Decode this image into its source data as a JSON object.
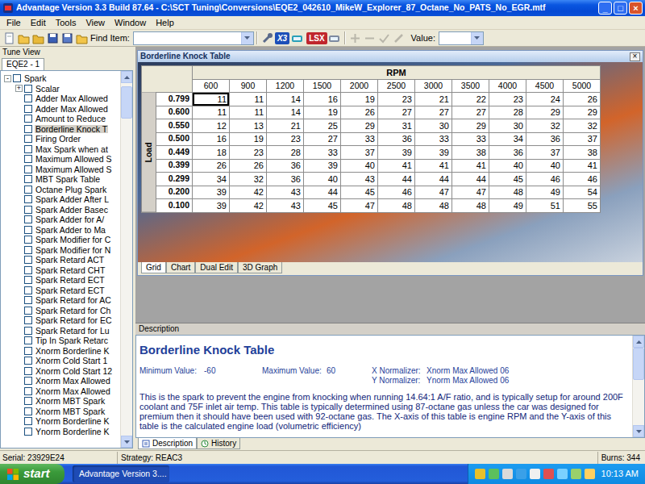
{
  "window": {
    "title": "Advantage Version 3.3 Build 87.64 - C:\\SCT Tuning\\Conversions\\EQE2_042610_MikeW_Explorer_87_Octane_No_PATS_No_EGR.mtf",
    "controls": [
      "_",
      "□",
      "×"
    ]
  },
  "menu": [
    "File",
    "Edit",
    "Tools",
    "View",
    "Window",
    "Help"
  ],
  "toolbar": {
    "find_label": "Find Item:",
    "value_label": "Value:",
    "badges": [
      {
        "label": "X3",
        "color": "#1d4fb8"
      },
      {
        "label": "LSX",
        "color": "#c0262d"
      }
    ]
  },
  "tune_view": {
    "title": "Tune View",
    "tab": {
      "label": "EQE2 - 1",
      "selected": true
    },
    "tree": [
      {
        "label": "Spark",
        "depth": 0,
        "toggle": "-",
        "checked": false,
        "selected": false
      },
      {
        "label": "Scalar",
        "depth": 1,
        "toggle": "+",
        "checked": false,
        "selected": false
      },
      {
        "label": "Adder Max Allowed",
        "depth": 1,
        "toggle": "",
        "checked": false,
        "selected": false
      },
      {
        "label": "Adder Max Allowed",
        "depth": 1,
        "toggle": "",
        "checked": false,
        "selected": false
      },
      {
        "label": "Amount to Reduce",
        "depth": 1,
        "toggle": "",
        "checked": false,
        "selected": false
      },
      {
        "label": "Borderline Knock T",
        "depth": 1,
        "toggle": "",
        "checked": false,
        "selected": true
      },
      {
        "label": "Firing Order",
        "depth": 1,
        "toggle": "",
        "checked": false,
        "selected": false
      },
      {
        "label": "Max Spark when at",
        "depth": 1,
        "toggle": "",
        "checked": false,
        "selected": false
      },
      {
        "label": "Maximum Allowed S",
        "depth": 1,
        "toggle": "",
        "checked": false,
        "selected": false
      },
      {
        "label": "Maximum Allowed S",
        "depth": 1,
        "toggle": "",
        "checked": false,
        "selected": false
      },
      {
        "label": "MBT Spark Table",
        "depth": 1,
        "toggle": "",
        "checked": false,
        "selected": false
      },
      {
        "label": "Octane Plug Spark",
        "depth": 1,
        "toggle": "",
        "checked": false,
        "selected": false
      },
      {
        "label": "Spark Adder After L",
        "depth": 1,
        "toggle": "",
        "checked": false,
        "selected": false
      },
      {
        "label": "Spark Adder Basec",
        "depth": 1,
        "toggle": "",
        "checked": false,
        "selected": false
      },
      {
        "label": "Spark Adder for A/",
        "depth": 1,
        "toggle": "",
        "checked": false,
        "selected": false
      },
      {
        "label": "Spark Adder to Ma",
        "depth": 1,
        "toggle": "",
        "checked": false,
        "selected": false
      },
      {
        "label": "Spark Modifier for C",
        "depth": 1,
        "toggle": "",
        "checked": false,
        "selected": false
      },
      {
        "label": "Spark Modifier for N",
        "depth": 1,
        "toggle": "",
        "checked": false,
        "selected": false
      },
      {
        "label": "Spark Retard ACT",
        "depth": 1,
        "toggle": "",
        "checked": false,
        "selected": false
      },
      {
        "label": "Spark Retard CHT",
        "depth": 1,
        "toggle": "",
        "checked": false,
        "selected": false
      },
      {
        "label": "Spark Retard ECT",
        "depth": 1,
        "toggle": "",
        "checked": false,
        "selected": false
      },
      {
        "label": "Spark Retard ECT",
        "depth": 1,
        "toggle": "",
        "checked": false,
        "selected": false
      },
      {
        "label": "Spark Retard for AC",
        "depth": 1,
        "toggle": "",
        "checked": false,
        "selected": false
      },
      {
        "label": "Spark Retard for Ch",
        "depth": 1,
        "toggle": "",
        "checked": false,
        "selected": false
      },
      {
        "label": "Spark Retard for EC",
        "depth": 1,
        "toggle": "",
        "checked": false,
        "selected": false
      },
      {
        "label": "Spark Retard for Lu",
        "depth": 1,
        "toggle": "",
        "checked": false,
        "selected": false
      },
      {
        "label": "Tip In Spark Retarc",
        "depth": 1,
        "toggle": "",
        "checked": false,
        "selected": false
      },
      {
        "label": "Xnorm Borderline K",
        "depth": 1,
        "toggle": "",
        "checked": false,
        "selected": false
      },
      {
        "label": "Xnorm Cold Start 1",
        "depth": 1,
        "toggle": "",
        "checked": false,
        "selected": false
      },
      {
        "label": "Xnorm Cold Start 12",
        "depth": 1,
        "toggle": "",
        "checked": false,
        "selected": false
      },
      {
        "label": "Xnorm Max Allowed",
        "depth": 1,
        "toggle": "",
        "checked": false,
        "selected": false
      },
      {
        "label": "Xnorm Max Allowed",
        "depth": 1,
        "toggle": "",
        "checked": false,
        "selected": false
      },
      {
        "label": "Xnorm MBT Spark",
        "depth": 1,
        "toggle": "",
        "checked": false,
        "selected": false
      },
      {
        "label": "Xnorm MBT Spark",
        "depth": 1,
        "toggle": "",
        "checked": false,
        "selected": false
      },
      {
        "label": "Ynorm Borderline K",
        "depth": 1,
        "toggle": "",
        "checked": false,
        "selected": false
      },
      {
        "label": "Ynorm Borderline K",
        "depth": 1,
        "toggle": "",
        "checked": false,
        "selected": false
      }
    ]
  },
  "table_window": {
    "title": "Borderline Knock Table",
    "close": "×",
    "x_axis": "RPM",
    "y_axis": "Load",
    "columns": [
      "600",
      "900",
      "1200",
      "1500",
      "2000",
      "2500",
      "3000",
      "3500",
      "4000",
      "4500",
      "5000"
    ],
    "selected_cell": [
      0,
      0
    ],
    "rows": [
      {
        "load": "0.799",
        "cells": [
          "11",
          "11",
          "14",
          "16",
          "19",
          "23",
          "21",
          "22",
          "23",
          "24",
          "26"
        ]
      },
      {
        "load": "0.600",
        "cells": [
          "11",
          "11",
          "14",
          "19",
          "26",
          "27",
          "27",
          "27",
          "28",
          "29",
          "29"
        ]
      },
      {
        "load": "0.550",
        "cells": [
          "12",
          "13",
          "21",
          "25",
          "29",
          "31",
          "30",
          "29",
          "30",
          "32",
          "32"
        ]
      },
      {
        "load": "0.500",
        "cells": [
          "16",
          "19",
          "23",
          "27",
          "33",
          "36",
          "33",
          "33",
          "34",
          "36",
          "37"
        ]
      },
      {
        "load": "0.449",
        "cells": [
          "18",
          "23",
          "28",
          "33",
          "37",
          "39",
          "39",
          "38",
          "36",
          "37",
          "38"
        ]
      },
      {
        "load": "0.399",
        "cells": [
          "26",
          "26",
          "36",
          "39",
          "40",
          "41",
          "41",
          "41",
          "40",
          "40",
          "41"
        ]
      },
      {
        "load": "0.299",
        "cells": [
          "34",
          "32",
          "36",
          "40",
          "43",
          "44",
          "44",
          "44",
          "45",
          "46",
          "46"
        ]
      },
      {
        "load": "0.200",
        "cells": [
          "39",
          "42",
          "43",
          "44",
          "45",
          "46",
          "47",
          "47",
          "48",
          "49",
          "54"
        ]
      },
      {
        "load": "0.100",
        "cells": [
          "39",
          "42",
          "43",
          "45",
          "47",
          "48",
          "48",
          "48",
          "49",
          "51",
          "55"
        ]
      }
    ],
    "tabs": [
      {
        "label": "Grid",
        "selected": true
      },
      {
        "label": "Chart",
        "selected": false
      },
      {
        "label": "Dual Edit",
        "selected": false
      },
      {
        "label": "3D Graph",
        "selected": false
      }
    ]
  },
  "description": {
    "header": "Description",
    "title": "Borderline Knock Table",
    "min_label": "Minimum Value:",
    "min": "-60",
    "max_label": "Maximum Value:",
    "max": "60",
    "x_norm_label": "X Normalizer:",
    "x_norm": "Xnorm Max Allowed 06",
    "y_norm_label": "Y Normalizer:",
    "y_norm": "Ynorm Max Allowed 06",
    "text": "This is the spark to prevent the engine from knocking when running 14.64:1 A/F ratio, and is typically setup for around 200F coolant and 75F inlet air temp. This table is typically determined using 87-octane gas unless the car was designed for premium then it should have been used with 92-octane gas. The X-axis of this table is engine RPM and the Y-axis of this table is the calculated engine load (volumetric efficiency)",
    "tabs": [
      {
        "label": "Description",
        "selected": true
      },
      {
        "label": "History",
        "selected": false
      }
    ]
  },
  "status_bar": {
    "serial": "Serial: 23929E24",
    "strategy": "Strategy: REAC3",
    "burns": "Burns: 344"
  },
  "taskbar": {
    "start": "start",
    "apps": [
      {
        "label": "Advantage Version 3....",
        "selected": true
      }
    ],
    "clock": "10:13 AM"
  }
}
